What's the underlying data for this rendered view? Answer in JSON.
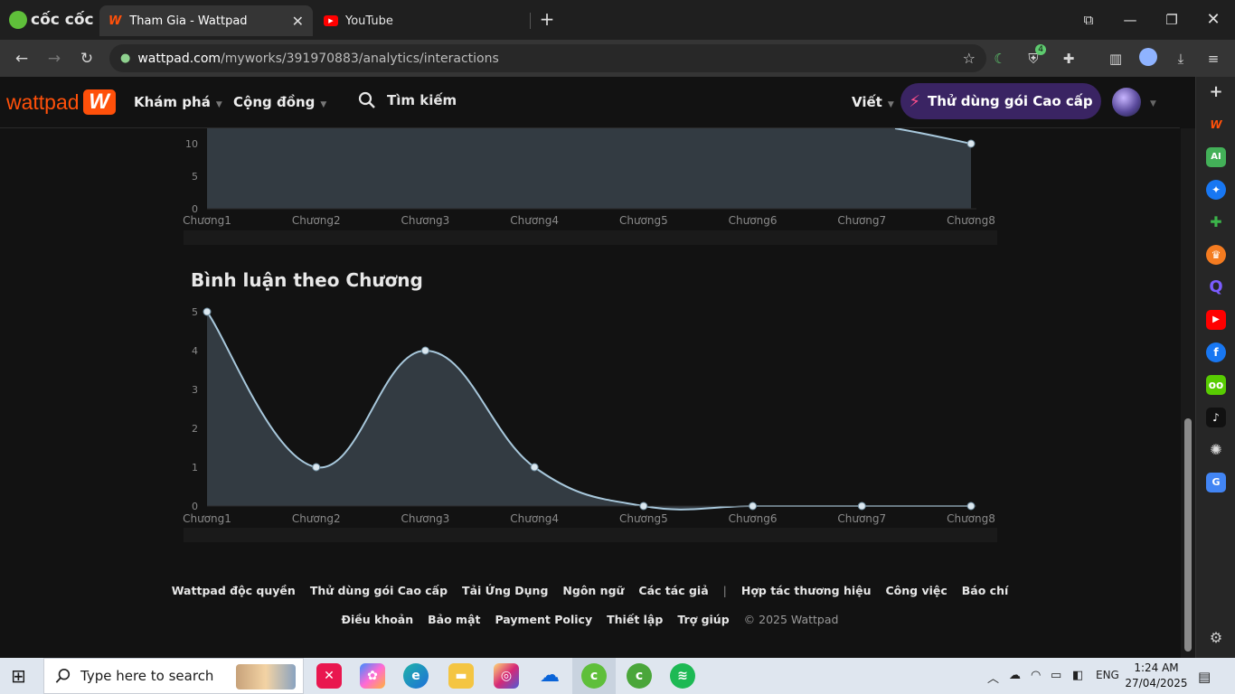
{
  "browser": {
    "brand": "cốc cốc",
    "tabs": [
      {
        "title": "Tham Gia - Wattpad",
        "active": true
      },
      {
        "title": "YouTube",
        "active": false
      }
    ],
    "url_host": "wattpad.com",
    "url_path": "/myworks/391970883/analytics/interactions",
    "extension_badge": "4"
  },
  "header": {
    "logo": "wattpad",
    "nav": [
      "Khám phá",
      "Cộng đồng"
    ],
    "search_label": "Tìm kiếm",
    "write_label": "Viết",
    "premium_label": "Thử dùng gói Cao cấp"
  },
  "chart1": {
    "y_ticks": [
      "0",
      "5",
      "10"
    ],
    "categories": [
      "Chương1",
      "Chương2",
      "Chương3",
      "Chương4",
      "Chương5",
      "Chương6",
      "Chương7",
      "Chương8"
    ]
  },
  "chart2": {
    "title": "Bình luận theo Chương",
    "y_ticks": [
      "0",
      "1",
      "2",
      "3",
      "4",
      "5"
    ]
  },
  "chart_data": [
    {
      "type": "area",
      "categories": [
        "Chương1",
        "Chương2",
        "Chương3",
        "Chương4",
        "Chương5",
        "Chương6",
        "Chương7",
        "Chương8"
      ],
      "series": [
        {
          "values": [
            null,
            null,
            null,
            null,
            null,
            null,
            null,
            10
          ]
        }
      ],
      "ylim": [
        0,
        10
      ],
      "note_visible": "only lower portion visible; last point = 10"
    },
    {
      "type": "area",
      "title": "Bình luận theo Chương",
      "categories": [
        "Chương1",
        "Chương2",
        "Chương3",
        "Chương4",
        "Chương5",
        "Chương6",
        "Chương7",
        "Chương8"
      ],
      "series": [
        {
          "values": [
            5,
            1,
            4,
            1,
            0,
            0,
            0,
            0
          ]
        }
      ],
      "ylim": [
        0,
        5
      ],
      "colors": {
        "line": "#a8c8dc",
        "fill": "#333b42"
      }
    }
  ],
  "footer": {
    "row1": [
      "Wattpad độc quyền",
      "Thử dùng gói Cao cấp",
      "Tải Ứng Dụng",
      "Ngôn ngữ",
      "Các tác giả",
      "|",
      "Hợp tác thương hiệu",
      "Công việc",
      "Báo chí"
    ],
    "row2": [
      "Điều khoản",
      "Bảo mật",
      "Payment Policy",
      "Thiết lập",
      "Trợ giúp"
    ],
    "copyright": "© 2025 Wattpad"
  },
  "taskbar": {
    "search_placeholder": "Type here to search",
    "lang": "ENG",
    "time": "1:24 AM",
    "date": "27/04/2025"
  }
}
